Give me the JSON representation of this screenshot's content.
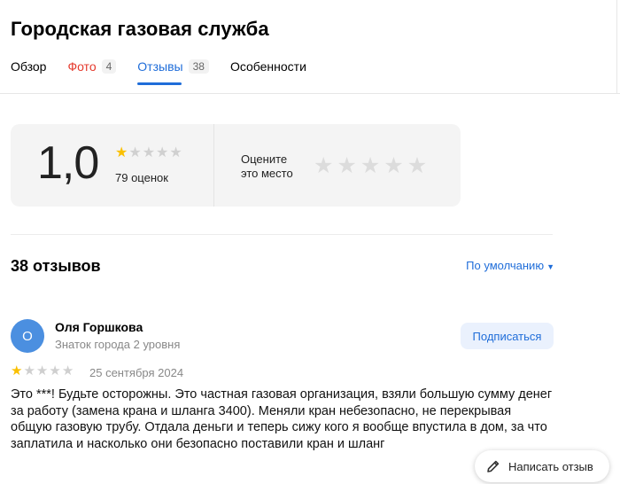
{
  "header": {
    "title": "Городская газовая служба",
    "tabs": [
      {
        "label": "Обзор",
        "count": ""
      },
      {
        "label": "Фото",
        "count": "4"
      },
      {
        "label": "Отзывы",
        "count": "38"
      },
      {
        "label": "Особенности",
        "count": ""
      }
    ]
  },
  "rating": {
    "value": "1,0",
    "stars": 1,
    "count_label": "79 оценок",
    "rate_label_line1": "Оцените",
    "rate_label_line2": "это место"
  },
  "reviews": {
    "header": "38 отзывов",
    "sort_label": "По умолчанию",
    "items": [
      {
        "avatar_letter": "О",
        "author": "Оля Горшкова",
        "level": "Знаток города 2 уровня",
        "subscribe_label": "Подписаться",
        "stars": 1,
        "date": "25 сентября 2024",
        "text": "Это ***! Будьте осторожны. Это частная газовая организация, взяли большую сумму денег за работу (замена крана и шланга 3400). Меняли кран небезопасно, не перекрывая общую газовую трубу. Отдала деньги и теперь сижу кого я вообще впустила в дом, за что заплатила и насколько они безопасно поставили кран и шланг"
      }
    ]
  },
  "actions": {
    "write_review_label": "Написать отзыв"
  },
  "colors": {
    "accent": "#1f6dd9",
    "photo_tab": "#e53a2d",
    "star_on": "#fac000",
    "avatar": "#4b8fe0"
  }
}
